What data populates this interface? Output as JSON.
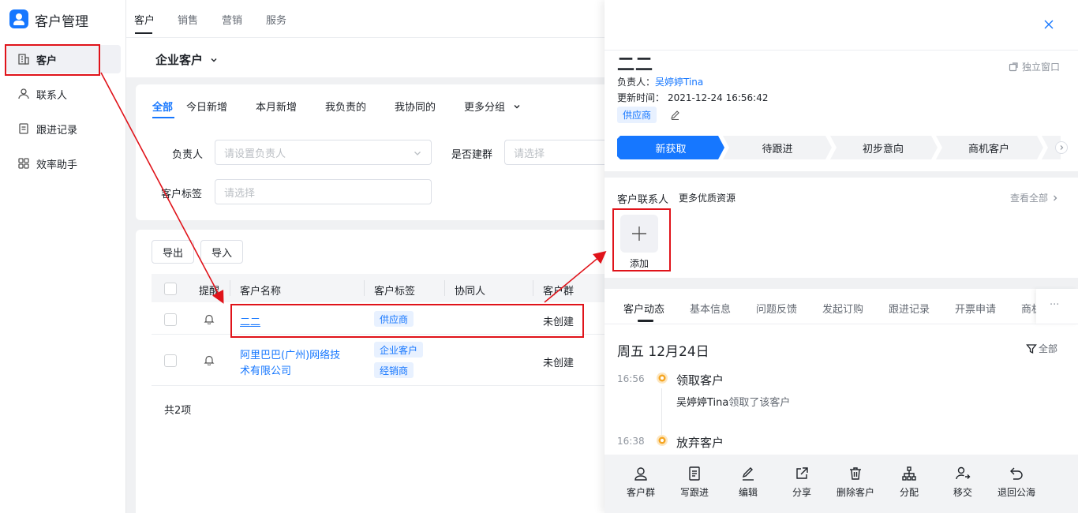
{
  "app": {
    "title": "客户管理"
  },
  "top_nav": [
    "客户",
    "销售",
    "营销",
    "服务"
  ],
  "sidebar": {
    "items": [
      {
        "label": "客户",
        "icon": "building-icon"
      },
      {
        "label": "联系人",
        "icon": "person-icon"
      },
      {
        "label": "跟进记录",
        "icon": "record-icon"
      },
      {
        "label": "效率助手",
        "icon": "grid-icon"
      }
    ]
  },
  "main": {
    "customer_type": "企业客户",
    "filter_tabs": [
      "全部",
      "今日新增",
      "本月新增",
      "我负责的",
      "我协同的",
      "更多分组"
    ],
    "filters": {
      "owner_label": "负责人",
      "owner_placeholder": "请设置负责人",
      "group_label": "是否建群",
      "group_placeholder": "请选择",
      "tag_label": "客户标签",
      "tag_placeholder": "请选择"
    },
    "buttons": {
      "export": "导出",
      "import": "导入"
    },
    "columns": [
      "提醒",
      "客户名称",
      "客户标签",
      "协同人",
      "客户群"
    ],
    "rows": [
      {
        "name": "二二",
        "tags": [
          "供应商"
        ],
        "group": "未创建"
      },
      {
        "name_line1": "阿里巴巴(广州)网络技",
        "name_line2": "术有限公司",
        "tags": [
          "企业客户",
          "经销商"
        ],
        "group": "未创建"
      }
    ],
    "total": "共2项"
  },
  "drawer": {
    "name": "二二",
    "standalone": "独立窗口",
    "owner_label": "负责人：",
    "owner": "吴婷婷Tina",
    "updated_label": "更新时间：",
    "updated": "2021-12-24 16:56:42",
    "tag": "供应商",
    "stages": [
      "新获取",
      "待跟进",
      "初步意向",
      "商机客户"
    ],
    "contacts_label": "客户联系人",
    "more_resources": "更多优质资源",
    "view_all": "查看全部",
    "add_label": "添加",
    "tabs": [
      "客户动态",
      "基本信息",
      "问题反馈",
      "发起订购",
      "跟进记录",
      "开票申请",
      "商机"
    ],
    "more": "···",
    "date_header": "周五 12月24日",
    "filter_all": "全部",
    "timeline": [
      {
        "time": "16:56",
        "title": "领取客户",
        "actor": "吴婷婷Tina",
        "desc": "领取了该客户"
      },
      {
        "time": "16:38",
        "title": "放弃客户"
      }
    ],
    "actions": [
      {
        "label": "客户群",
        "icon": "group-icon"
      },
      {
        "label": "写跟进",
        "icon": "note-icon"
      },
      {
        "label": "编辑",
        "icon": "pencil-icon"
      },
      {
        "label": "分享",
        "icon": "share-icon"
      },
      {
        "label": "删除客户",
        "icon": "trash-icon"
      },
      {
        "label": "分配",
        "icon": "assign-icon"
      },
      {
        "label": "移交",
        "icon": "transfer-icon"
      },
      {
        "label": "退回公海",
        "icon": "return-icon"
      }
    ]
  },
  "colors": {
    "accent": "#1677ff",
    "annotation_red": "#e0131a",
    "timeline_dot": "#f5a623"
  }
}
